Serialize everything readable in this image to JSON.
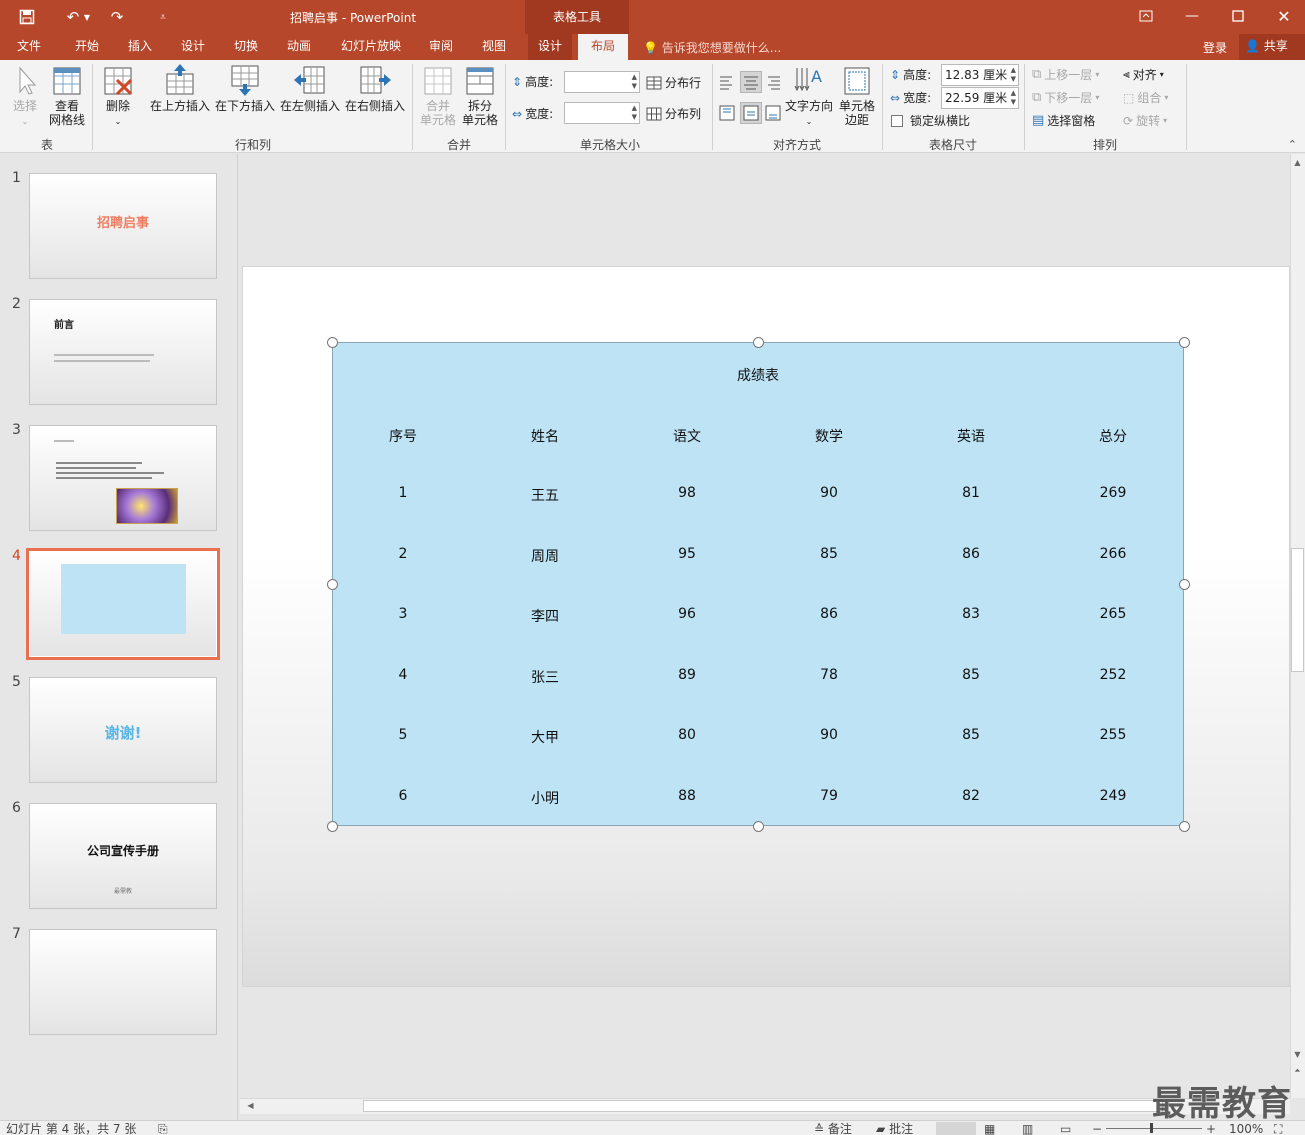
{
  "window": {
    "title": "招聘启事 - PowerPoint",
    "context_tab_group": "表格工具"
  },
  "tabs": [
    {
      "label": "文件"
    },
    {
      "label": "开始"
    },
    {
      "label": "插入"
    },
    {
      "label": "设计"
    },
    {
      "label": "切换"
    },
    {
      "label": "动画"
    },
    {
      "label": "幻灯片放映"
    },
    {
      "label": "审阅"
    },
    {
      "label": "视图"
    },
    {
      "label": "设计"
    },
    {
      "label": "布局",
      "active": true
    }
  ],
  "tellme": "告诉我您想要做什么...",
  "account": {
    "login": "登录",
    "share": "共享"
  },
  "ribbon": {
    "table_group": {
      "select": "选择",
      "view_grid": "查看\n网格线",
      "label": "表"
    },
    "rows_cols": {
      "delete": "删除",
      "insert_above": "在上方插入",
      "insert_below": "在下方插入",
      "insert_left": "在左侧插入",
      "insert_right": "在右侧插入",
      "label": "行和列"
    },
    "merge": {
      "merge_cells": "合并\n单元格",
      "split_cells": "拆分\n单元格",
      "label": "合并"
    },
    "cell_size": {
      "height_label": "高度:",
      "width_label": "宽度:",
      "height_value": "",
      "width_value": "",
      "distribute_rows": "分布行",
      "distribute_cols": "分布列",
      "label": "单元格大小"
    },
    "alignment": {
      "text_direction": "文字方向",
      "cell_margins": "单元格\n边距",
      "label": "对齐方式"
    },
    "table_size": {
      "height_label": "高度:",
      "width_label": "宽度:",
      "height_value": "12.83 厘米",
      "width_value": "22.59 厘米",
      "lock_ratio": "锁定纵横比",
      "label": "表格尺寸"
    },
    "arrange": {
      "bring_forward": "上移一层",
      "send_backward": "下移一层",
      "selection_pane": "选择窗格",
      "align": "对齐",
      "group": "组合",
      "rotate": "旋转",
      "label": "排列"
    }
  },
  "thumbnails": [
    {
      "num": "1",
      "title": "招聘启事"
    },
    {
      "num": "2",
      "title": "前言"
    },
    {
      "num": "3",
      "title": ""
    },
    {
      "num": "4",
      "title": "",
      "active": true
    },
    {
      "num": "5",
      "title": "谢谢!"
    },
    {
      "num": "6",
      "title": "公司宣传手册",
      "subtitle": "最需教"
    },
    {
      "num": "7",
      "title": ""
    }
  ],
  "table": {
    "title": "成绩表",
    "headers": [
      "序号",
      "姓名",
      "语文",
      "数学",
      "英语",
      "总分"
    ],
    "rows": [
      [
        "1",
        "王五",
        "98",
        "90",
        "81",
        "269"
      ],
      [
        "2",
        "周周",
        "95",
        "85",
        "86",
        "266"
      ],
      [
        "3",
        "李四",
        "96",
        "86",
        "83",
        "265"
      ],
      [
        "4",
        "张三",
        "89",
        "78",
        "85",
        "252"
      ],
      [
        "5",
        "大甲",
        "80",
        "90",
        "85",
        "255"
      ],
      [
        "6",
        "小明",
        "88",
        "79",
        "82",
        "249"
      ]
    ]
  },
  "status": {
    "slide_info": "幻灯片 第 4 张，共 7 张",
    "notes": "备注",
    "comments": "批注",
    "zoom": "100%"
  },
  "watermark": "最需教育",
  "colors": {
    "accent": "#b7472a",
    "table_fill": "#bde3f5",
    "selection": "#e96f51"
  }
}
